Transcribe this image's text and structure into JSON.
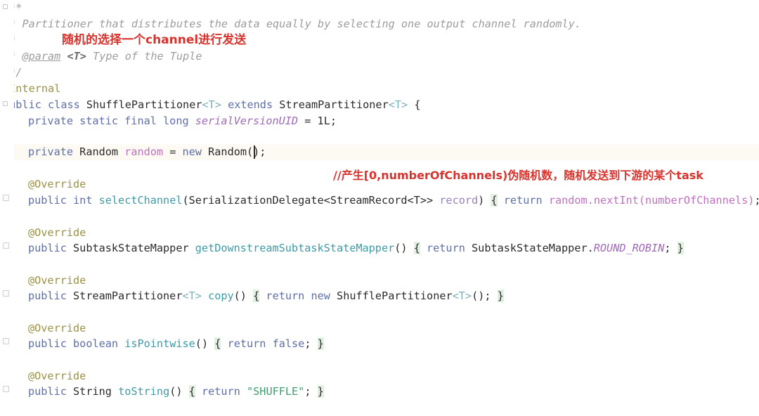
{
  "editor": {
    "language": "java",
    "theme": "intellij-light",
    "background": "#ffffff",
    "current_line_background": "#fcfaf2",
    "annotation_color": "#d8342e"
  },
  "annotations": {
    "top_note": "随机的选择一个channel进行发送",
    "inner_note": "//产生[0,numberOfChannels)伪随机数，随机发送到下游的某个task"
  },
  "code": {
    "javadoc": {
      "open": "/**",
      "line_desc_prefix": " * ",
      "line_desc": "Partitioner that distributes the data equally by selecting one output channel randomly.",
      "line_blank": " *",
      "param_star": " * ",
      "param_tag": "@param",
      "param_type": "<T>",
      "param_desc": " Type of the Tuple",
      "close": " */"
    },
    "annotation_internal": "@Internal",
    "class_decl": {
      "modifier": "public",
      "keyword": "class",
      "name": "ShufflePartitioner",
      "generic": "<T>",
      "extends_kw": "extends",
      "super": "StreamPartitioner",
      "super_generic": "<T>",
      "brace": "{"
    },
    "serial_field": {
      "modifiers": "private static final",
      "type": "long",
      "name": "serialVersionUID",
      "assign": "=",
      "value": "1L",
      "semi": ";"
    },
    "random_field": {
      "modifier": "private",
      "type": "Random",
      "name": "random",
      "assign": "=",
      "new_kw": "new",
      "ctor": "Random()",
      "semi": ";"
    },
    "override": "@Override",
    "methods": [
      {
        "modifier": "public",
        "return_type": "int",
        "name": "selectChannel",
        "params_type": "SerializationDelegate<StreamRecord<T>>",
        "param_name": "record",
        "body_return": "return",
        "body_expr": "random.nextInt(numberOfChannels)",
        "open_brace": "{",
        "close_brace": "}"
      },
      {
        "modifier": "public",
        "return_type": "SubtaskStateMapper",
        "name": "getDownstreamSubtaskStateMapper",
        "params_type": "",
        "param_name": "",
        "body_return": "return",
        "body_expr": "SubtaskStateMapper.ROUND_ROBIN",
        "open_brace": "{",
        "close_brace": "}"
      },
      {
        "modifier": "public",
        "return_type": "StreamPartitioner<T>",
        "name": "copy",
        "params_type": "",
        "param_name": "",
        "body_return": "return",
        "body_expr": "new ShufflePartitioner<T>()",
        "open_brace": "{",
        "close_brace": "}"
      },
      {
        "modifier": "public",
        "return_type": "boolean",
        "name": "isPointwise",
        "params_type": "",
        "param_name": "",
        "body_return": "return",
        "body_expr": "false",
        "open_brace": "{",
        "close_brace": "}"
      },
      {
        "modifier": "public",
        "return_type": "String",
        "name": "toString",
        "params_type": "",
        "param_name": "",
        "body_return": "return",
        "body_expr": "\"SHUFFLE\"",
        "open_brace": "{",
        "close_brace": "}"
      }
    ],
    "class_close": "}"
  },
  "tokens": {
    "kw_public": "public",
    "kw_private": "private",
    "kw_static": "static",
    "kw_final": "final",
    "kw_class": "class",
    "kw_extends": "extends",
    "kw_new": "new",
    "kw_return": "return",
    "kw_long": "long",
    "kw_int": "int",
    "kw_boolean": "boolean",
    "kw_false": "false",
    "sp": " ",
    "semi": ";",
    "assign": "=",
    "lt_t_gt": "<T>",
    "paren_empty": "()",
    "dot": ".",
    "comma_sp": ", "
  }
}
